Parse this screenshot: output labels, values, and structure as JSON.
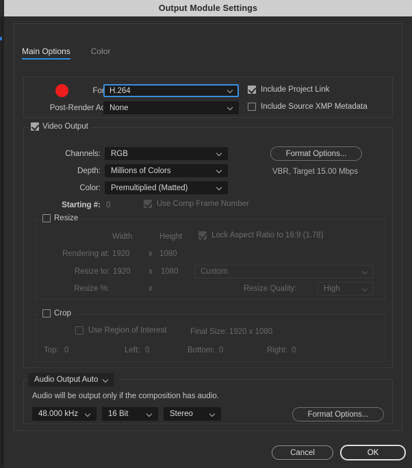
{
  "window": {
    "title": "Output Module Settings"
  },
  "tabs": [
    {
      "label": "Main Options",
      "active": true
    },
    {
      "label": "Color",
      "active": false
    }
  ],
  "format_group": {
    "format_label": "Format:",
    "format_value": "H.264",
    "post_render_label": "Post-Render Action:",
    "post_render_value": "None",
    "include_project_link": "Include Project Link",
    "include_xmp": "Include Source XMP Metadata",
    "annotation_color": "#ee1c1c"
  },
  "video_output": {
    "legend": "Video Output",
    "channels_label": "Channels:",
    "channels_value": "RGB",
    "depth_label": "Depth:",
    "depth_value": "Millions of Colors",
    "color_label": "Color:",
    "color_value": "Premultiplied (Matted)",
    "starting_label": "Starting #:",
    "starting_value": "0",
    "use_comp_frame_number": "Use Comp Frame Number",
    "format_options_button": "Format Options...",
    "bitrate_info": "VBR, Target 15.00 Mbps"
  },
  "resize": {
    "legend": "Resize",
    "width_header": "Width",
    "height_header": "Height",
    "lock_aspect": "Lock Aspect Ratio to 16:9 (1.78)",
    "rendering_at_label": "Rendering at:",
    "rendering_at_width": "1920",
    "rendering_at_x": "x",
    "rendering_at_height": "1080",
    "resize_to_label": "Resize to:",
    "resize_to_width": "1920",
    "resize_to_x": "x",
    "resize_to_height": "1080",
    "preset_value": "Custom",
    "resize_pct_label": "Resize %:",
    "resize_pct_x": "x",
    "resize_quality_label": "Resize Quality:",
    "resize_quality_value": "High"
  },
  "crop": {
    "legend": "Crop",
    "use_region_of_interest": "Use Region of Interest",
    "final_size": "Final Size: 1920 x 1080",
    "top_label": "Top:",
    "top_value": "0",
    "left_label": "Left:",
    "left_value": "0",
    "bottom_label": "Bottom:",
    "bottom_value": "0",
    "right_label": "Right:",
    "right_value": "0"
  },
  "audio": {
    "legend_value": "Audio Output Auto",
    "note": "Audio will be output only if the composition has audio.",
    "sample_rate": "48.000 kHz",
    "bit_depth": "16 Bit",
    "channels": "Stereo",
    "format_options_button": "Format Options..."
  },
  "footer": {
    "cancel": "Cancel",
    "ok": "OK"
  }
}
